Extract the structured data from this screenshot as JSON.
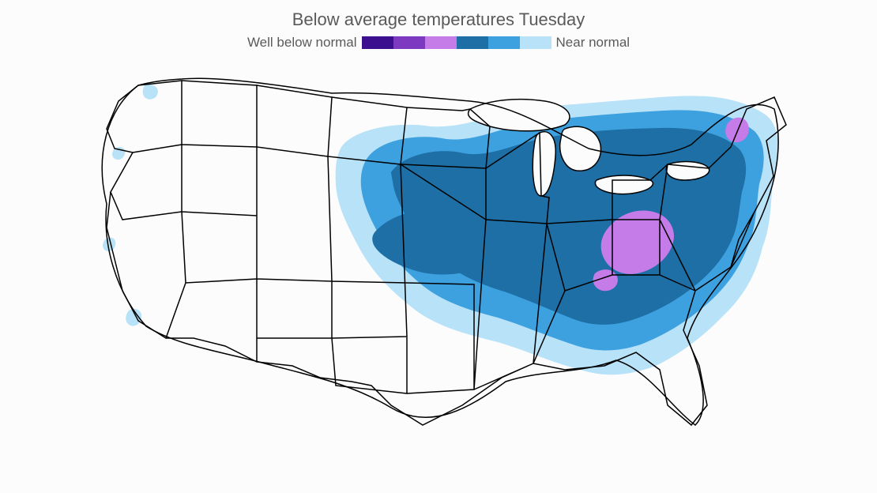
{
  "title": "Below average temperatures Tuesday",
  "legend": {
    "left_label": "Well below normal",
    "right_label": "Near normal",
    "colors": [
      {
        "name": "deep-purple",
        "hex": "#3c0f8f"
      },
      {
        "name": "purple",
        "hex": "#7d3ac1"
      },
      {
        "name": "light-purple",
        "hex": "#c57be8"
      },
      {
        "name": "dark-blue",
        "hex": "#1d6fa5"
      },
      {
        "name": "blue",
        "hex": "#3ea1df"
      },
      {
        "name": "light-blue",
        "hex": "#b8e2f8"
      }
    ]
  },
  "map": {
    "region": "Contiguous United States",
    "projection": "approximate Albers",
    "anomaly_zones": {
      "description": "Temperature anomaly bands, coldest (purple) innermost to near-normal (light blue) outermost",
      "coverage": "Great Plains, Midwest, Great Lakes, Ohio Valley, Appalachians, Mid-Atlantic, Northeast, interior Southeast",
      "coldest_pockets": [
        "West Virginia / western Virginia",
        "Vermont / New Hampshire"
      ]
    }
  }
}
